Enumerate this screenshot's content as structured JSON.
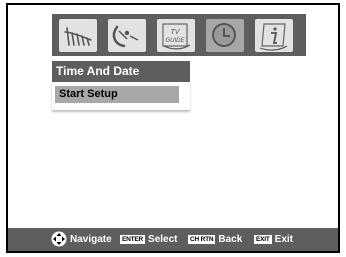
{
  "tabs": [
    {
      "name": "antenna-setup",
      "icon": "antenna-icon",
      "active": false
    },
    {
      "name": "satellite-setup",
      "icon": "satellite-dish-icon",
      "active": false
    },
    {
      "name": "tv-guide",
      "icon": "tv-guide-icon",
      "active": false,
      "lines": [
        "TV",
        "GUIDE"
      ]
    },
    {
      "name": "time-and-date",
      "icon": "clock-icon",
      "active": true
    },
    {
      "name": "info",
      "icon": "info-icon",
      "active": false
    }
  ],
  "menu": {
    "title": "Time And Date",
    "items": [
      "Start Setup"
    ]
  },
  "footer": {
    "navigate_label": "Navigate",
    "enter_key": "ENTER",
    "select_label": "Select",
    "chrtn_key": "CH RTN",
    "back_label": "Back",
    "exit_key": "EXIT",
    "exit_label": "Exit"
  },
  "colors": {
    "bar": "#5e5e5e",
    "tab": "#e2e2e2",
    "tab_active": "#a7a7a7",
    "highlight": "#a8a8a8"
  }
}
